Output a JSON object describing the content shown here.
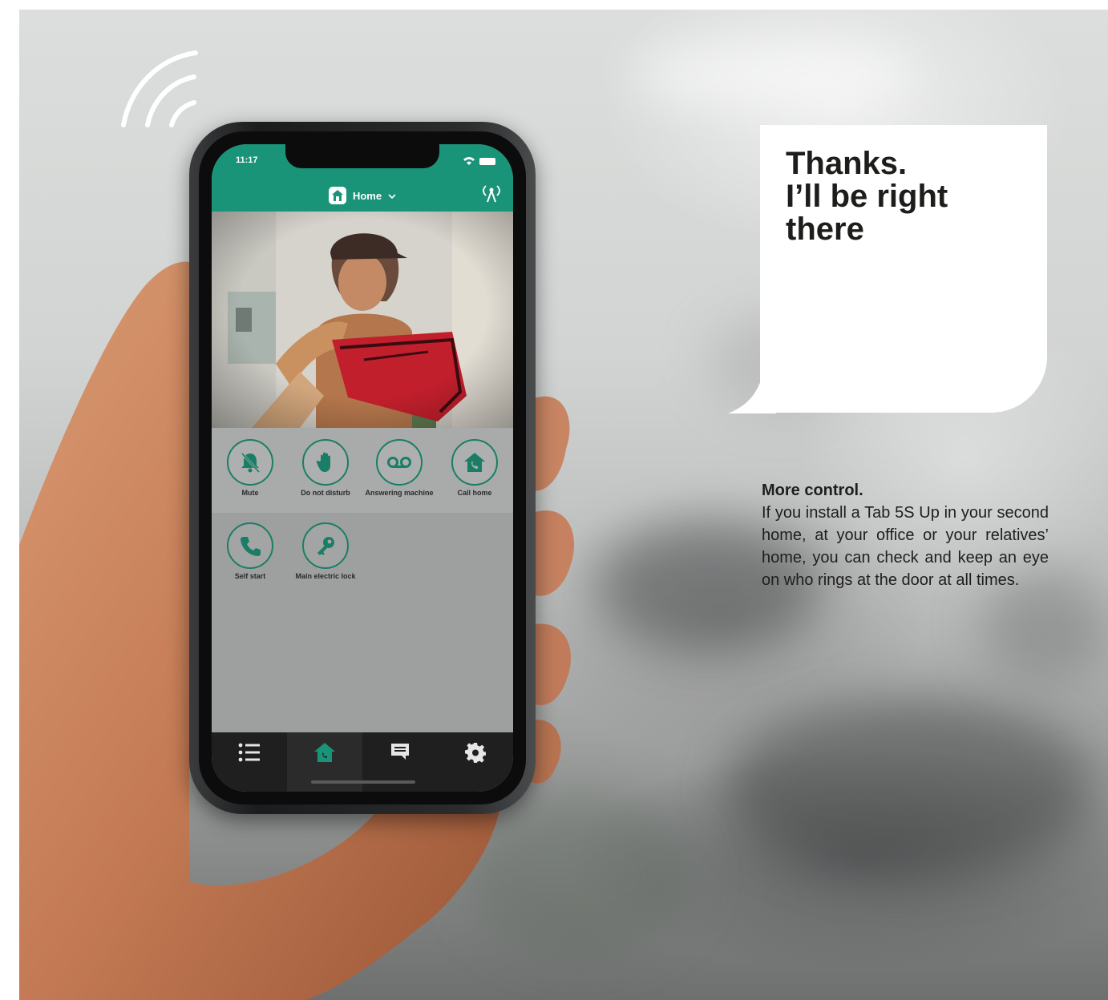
{
  "phone": {
    "status_time": "11:17",
    "header_title": "Home",
    "actions": [
      {
        "label": "Mute",
        "icon": "bell-muted-icon"
      },
      {
        "label": "Do not disturb",
        "icon": "hand-stop-icon"
      },
      {
        "label": "Answering machine",
        "icon": "voicemail-icon"
      },
      {
        "label": "Call home",
        "icon": "call-home-icon"
      },
      {
        "label": "Self start",
        "icon": "phone-icon"
      },
      {
        "label": "Main electric lock",
        "icon": "key-icon"
      }
    ],
    "nav": [
      "list-icon",
      "home-icon",
      "message-icon",
      "gear-icon"
    ],
    "accent": "#1a9478"
  },
  "bubble": {
    "line1": "Thanks.",
    "line2": "I’ll be right",
    "line3": "there"
  },
  "copy": {
    "title": "More control.",
    "body": "If you install a Tab 5S Up in your second home, at your office or your relatives’ home, you can check and keep an eye on who rings at the door at all times."
  }
}
